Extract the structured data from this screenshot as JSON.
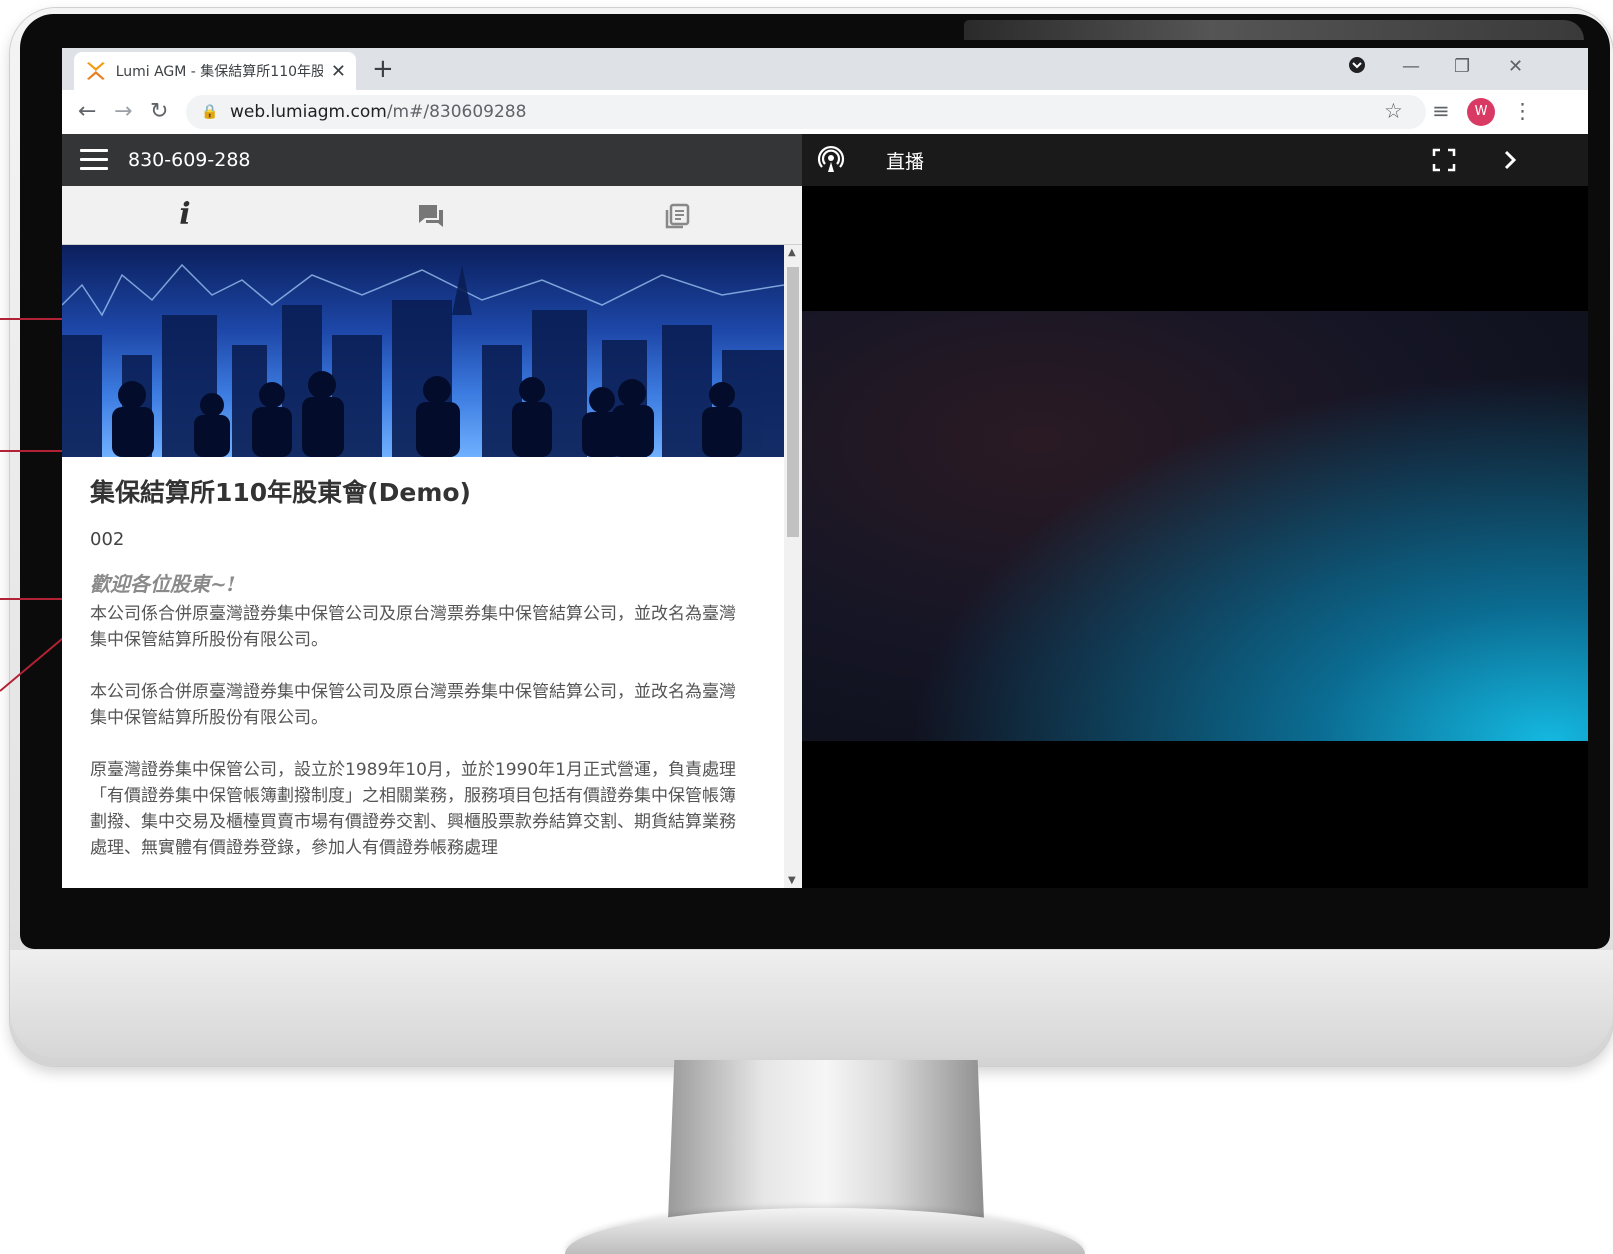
{
  "browser": {
    "tab_title": "Lumi AGM - 集保結算所110年股",
    "url_host": "web.lumiagm.com",
    "url_path": "/m#/830609288",
    "profile_initial": "W"
  },
  "app": {
    "meeting_id": "830-609-288",
    "live_label": "直播",
    "info_tab_glyph": "i",
    "meeting_title": "集保結算所110年股東會(Demo)",
    "meeting_code": "002",
    "welcome": "歡迎各位股東~!",
    "paragraphs": [
      "本公司係合併原臺灣證券集中保管公司及原台灣票券集中保管結算公司，並改名為臺灣集中保管結算所股份有限公司。",
      "本公司係合併原臺灣證券集中保管公司及原台灣票券集中保管結算公司，並改名為臺灣集中保管結算所股份有限公司。",
      "原臺灣證券集中保管公司，設立於1989年10月，並於1990年1月正式營運，負責處理「有價證券集中保管帳簿劃撥制度」之相關業務，服務項目包括有價證券集中保管帳簿劃撥、集中交易及櫃檯買賣市場有價證券交割、興櫃股票款券結算交割、期貨結算業務處理、無實體有價證券登錄，參加人有價證券帳務處理"
    ]
  },
  "colors": {
    "accent_red": "#d93a63",
    "header_dark": "#333537",
    "callout_red": "#b22234"
  },
  "icons": [
    "lumi-logo-icon",
    "close-icon",
    "plus-icon",
    "menu-icon",
    "chat-icon",
    "documents-icon",
    "broadcast-icon",
    "fullscreen-icon",
    "chevron-right-icon",
    "star-icon",
    "media-icon",
    "more-icon",
    "lock-icon",
    "back-icon",
    "forward-icon",
    "reload-icon",
    "profile-icon"
  ]
}
